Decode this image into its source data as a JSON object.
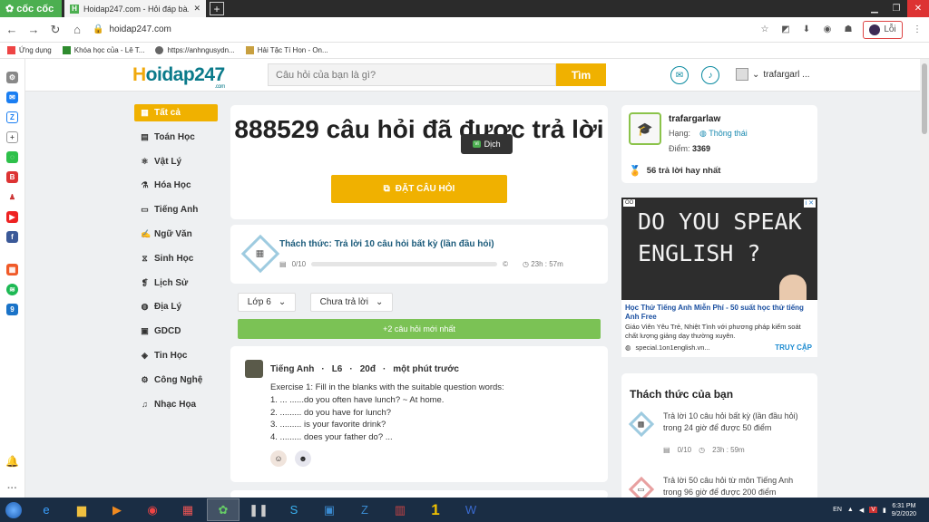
{
  "browser": {
    "brand": "cốc cốc",
    "tab_title": "Hoidap247.com - Hỏi đáp bà...",
    "tab_favicon": "H",
    "new_tab": "+",
    "url": "hoidap247.com",
    "profile_label": "Lỗi",
    "bookmarks": [
      "Ứng dụng",
      "Khóa học của - Lê T...",
      "https://anhngusydn...",
      "Hải Tặc Tí Hon - On..."
    ]
  },
  "site": {
    "logo_main": "oidap247",
    "logo_h": "H",
    "logo_sub": ".com",
    "search_placeholder": "Câu hỏi của bạn là gì?",
    "search_button": "Tìm",
    "header_user": "trafargarl ..."
  },
  "subjects": [
    {
      "label": "Tất cả",
      "icon": "grid-icon",
      "glyph": "▦",
      "active": true
    },
    {
      "label": "Toán Học",
      "icon": "calculator-icon",
      "glyph": "▤"
    },
    {
      "label": "Vật Lý",
      "icon": "atom-icon",
      "glyph": "⚛"
    },
    {
      "label": "Hóa Học",
      "icon": "flask-icon",
      "glyph": "⚗"
    },
    {
      "label": "Tiếng Anh",
      "icon": "abc-icon",
      "glyph": "▭"
    },
    {
      "label": "Ngữ Văn",
      "icon": "pen-icon",
      "glyph": "✍"
    },
    {
      "label": "Sinh Học",
      "icon": "dna-icon",
      "glyph": "⧖"
    },
    {
      "label": "Lịch Sử",
      "icon": "scroll-icon",
      "glyph": "❡"
    },
    {
      "label": "Địa Lý",
      "icon": "globe-icon",
      "glyph": "◍"
    },
    {
      "label": "GDCD",
      "icon": "people-icon",
      "glyph": "▣"
    },
    {
      "label": "Tin Học",
      "icon": "computer-icon",
      "glyph": "◈"
    },
    {
      "label": "Công Nghệ",
      "icon": "gear-icon",
      "glyph": "⚙"
    },
    {
      "label": "Nhạc Họa",
      "icon": "music-icon",
      "glyph": "♫"
    }
  ],
  "hero": {
    "title": "888529 câu hỏi đã được trả lời",
    "ask_button": "ĐẶT CÂU HỎI",
    "tooltip_lang": "vi",
    "tooltip_label": "Dịch"
  },
  "challenge": {
    "title": "Thách thức: Trả lời 10 câu hỏi  bất kỳ (lần đầu hỏi)",
    "progress_text": "0/10",
    "progress": 0,
    "time": "23h : 57m"
  },
  "filters": {
    "grade": "Lớp 6",
    "status": "Chưa trả lời"
  },
  "new_questions": "+2 câu hỏi mới nhất",
  "question": {
    "subject": "Tiếng Anh",
    "grade": "L6",
    "points": "20đ",
    "time": "một phút trước",
    "lines": [
      "Exercise 1: Fill in the blanks with the suitable question words:",
      "1. ... ......do you often have lunch? ~ At home.",
      "2. ......... do you have for lunch?",
      "3. ......... is your favorite drink?",
      "4. ......... does your father do? ..."
    ]
  },
  "user": {
    "name": "trafargarlaw",
    "rank_label": "Hạng:",
    "rank_value": "Thông thái",
    "points_label": "Điểm:",
    "points_value": "3369",
    "best_answers": "56 trả lời hay nhất"
  },
  "ad": {
    "image_line1": "DO YOU SPEAK",
    "image_line2": "ENGLISH ?",
    "title": "Học Thử Tiếng Anh Miễn Phí - 50 suất học thử tiếng Anh Free",
    "desc": "Giáo Viên Yêu Trẻ, Nhiệt Tình với phương pháp kiểm soát chất lượng giảng dạy thường xuyên.",
    "url": "special.1on1english.vn...",
    "cta": "TRUY CẬP"
  },
  "my_challenges": {
    "title": "Thách thức của bạn",
    "items": [
      {
        "text": "Trả lời 10 câu hỏi  bất kỳ (lần đầu hỏi) trong 24 giờ để được 50 điểm",
        "progress": "0/10",
        "time": "23h : 59m"
      },
      {
        "text": "Trả lời 50 câu hỏi  từ môn Tiếng Anh trong 96 giờ để được 200 điểm"
      }
    ]
  },
  "taskbar": {
    "lang": "EN",
    "time": "6:31 PM",
    "date": "9/2/2020"
  },
  "colors": {
    "accent": "#f0b100",
    "brand_teal": "#0a7a8a",
    "green": "#7bc255"
  }
}
